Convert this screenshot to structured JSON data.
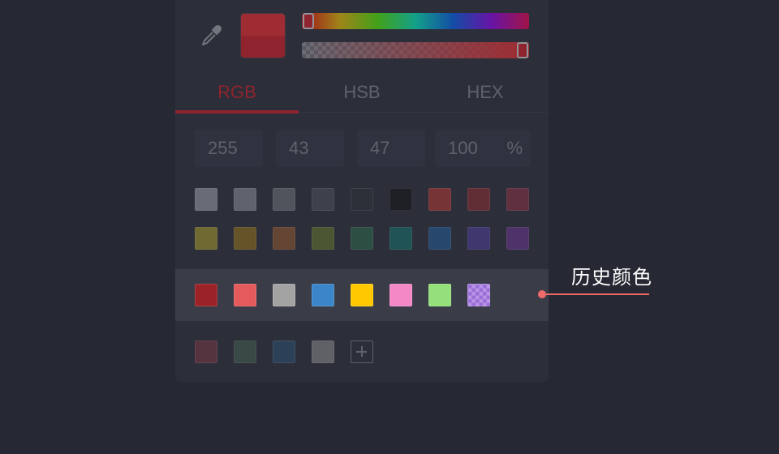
{
  "picker": {
    "current_color": "#ff2b2f",
    "previous_color": "#e01c26",
    "tabs": [
      {
        "label": "RGB",
        "active": true
      },
      {
        "label": "HSB",
        "active": false
      },
      {
        "label": "HEX",
        "active": false
      }
    ],
    "rgb": {
      "r": "255",
      "g": "43",
      "b": "47",
      "a": "100",
      "a_unit": "%"
    },
    "hue_fraction": 0.0,
    "alpha_fraction": 1.0
  },
  "presets": {
    "row1": [
      "#9aa0a8",
      "#8c9099",
      "#6f737c",
      "#4e525a",
      "#30333a",
      "#151618",
      "#b33a36",
      "#8f2f33",
      "#8b3247"
    ],
    "row2": [
      "#a89a2d",
      "#96741d",
      "#955830",
      "#67782f",
      "#2f6a4c",
      "#16726c",
      "#235c96",
      "#4f3f99",
      "#6a3791"
    ]
  },
  "history": {
    "label": "历史颜色",
    "swatches": [
      "#9b2226",
      "#e55b5b",
      "#a3a3a3",
      "#3a86c8",
      "#ffc800",
      "#f487c6",
      "#95e07a",
      "checker"
    ]
  },
  "custom": {
    "swatches": [
      "#7a3a45",
      "#45604f",
      "#2c5273",
      "#8a8c8e"
    ]
  }
}
